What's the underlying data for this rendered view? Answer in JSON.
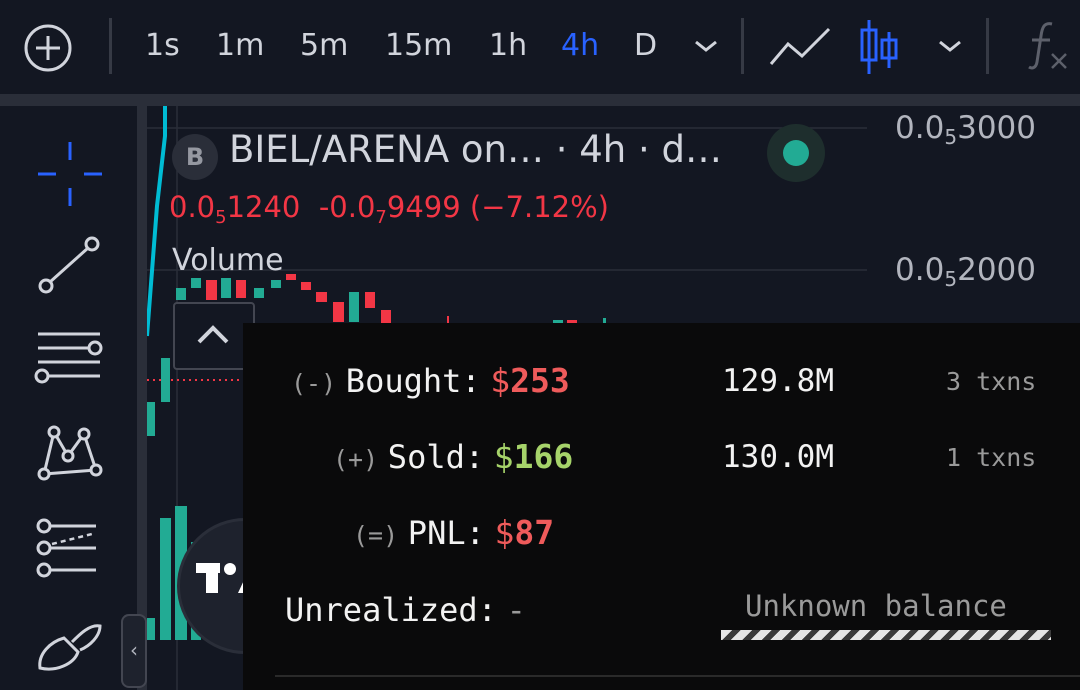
{
  "toolbar": {
    "intervals": [
      "1s",
      "1m",
      "5m",
      "15m",
      "1h",
      "4h",
      "D"
    ],
    "active_interval": "4h",
    "icons": [
      "add-circle-icon",
      "chevron-down-icon",
      "line-chart-icon",
      "candles-icon",
      "chevron-down-icon",
      "indicators-fx-icon"
    ]
  },
  "left_toolbar": {
    "tools": [
      "crosshair-icon",
      "trend-line-icon",
      "horizontal-lines-icon",
      "pattern-icon",
      "projection-icon",
      "brush-icon"
    ]
  },
  "legend": {
    "badge": "B",
    "title": "BIEL/ARENA on…  · 4h · d…",
    "price_main": "0.0",
    "price_sub": "5",
    "price_rest": "1240",
    "change_main": "-0.0",
    "change_sub": "7",
    "change_rest": "9499",
    "change_pct": "(−7.12%)",
    "volume_label": "Volume"
  },
  "price_scale": [
    {
      "main": "0.0",
      "sub": "5",
      "rest": "3000"
    },
    {
      "main": "0.0",
      "sub": "5",
      "rest": "2000"
    }
  ],
  "pnl": {
    "bought": {
      "sign": "(-)",
      "label": "Bought:",
      "dollar": "$",
      "amount": "253",
      "tokens": "129.8M",
      "txns": "3 txns"
    },
    "sold": {
      "sign": "(+)",
      "label": "Sold:",
      "dollar": "$",
      "amount": "166",
      "tokens": "130.0M",
      "txns": "1 txns"
    },
    "pnl": {
      "sign": "(=)",
      "label": "PNL:",
      "dollar": "$",
      "amount": "87"
    },
    "unrealized": {
      "label": "Unrealized:",
      "value": "-",
      "balance_text": "Unknown balance"
    }
  },
  "colors": {
    "accent": "#2962ff",
    "down": "#f23645",
    "up": "#22ab94",
    "loss": "#ef5b5b",
    "gain": "#a6d36a"
  }
}
